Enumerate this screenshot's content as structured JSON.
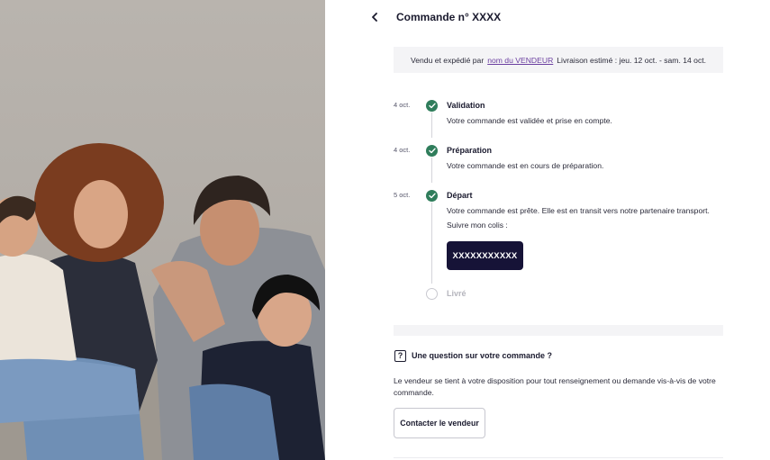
{
  "header": {
    "title": "Commande n° XXXX"
  },
  "seller_bar": {
    "prefix": "Vendu et expédié par",
    "seller_link": "nom du VENDEUR",
    "delivery": "Livraison estimé : jeu. 12 oct. - sam. 14 oct."
  },
  "timeline": [
    {
      "date": "4 oct.",
      "name": "Validation",
      "desc": "Votre commande est validée et prise en compte.",
      "done": true
    },
    {
      "date": "4 oct.",
      "name": "Préparation",
      "desc": "Votre commande est en cours de préparation.",
      "done": true
    },
    {
      "date": "5 oct.",
      "name": "Départ",
      "desc": "Votre commande est prête. Elle est en transit vers notre partenaire transport.",
      "desc2": "Suivre mon colis :",
      "done": true
    },
    {
      "date": "",
      "name": "Livré",
      "done": false
    }
  ],
  "tracking": {
    "button_label": "XXXXXXXXXXX"
  },
  "question": {
    "icon": "question-box-icon",
    "title": "Une question sur votre commande ?",
    "text": "Le vendeur se tient à votre disposition pour tout renseignement ou demande vis-à-vis de votre commande.",
    "button_label": "Contacter le vendeur"
  },
  "colors": {
    "done": "#2f7d5b",
    "primary_button": "#161337",
    "link": "#6b3fa0"
  }
}
